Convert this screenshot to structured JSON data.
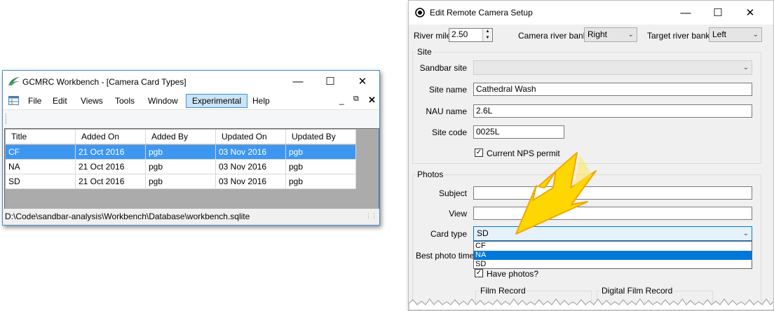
{
  "workbench": {
    "title": "GCMRC Workbench - [Camera Card Types]",
    "menu": [
      "File",
      "Edit",
      "Views",
      "Tools",
      "Window",
      "Experimental",
      "Help"
    ],
    "columns": [
      "Title",
      "Added On",
      "Added By",
      "Updated On",
      "Updated By"
    ],
    "rows": [
      [
        "CF",
        "21 Oct 2016",
        "pgb",
        "03 Nov 2016",
        "pgb"
      ],
      [
        "NA",
        "21 Oct 2016",
        "pgb",
        "03 Nov 2016",
        "pgb"
      ],
      [
        "SD",
        "21 Oct 2016",
        "pgb",
        "03 Nov 2016",
        "pgb"
      ]
    ],
    "status": "D:\\Code\\sandbar-analysis\\Workbench\\Database\\workbench.sqlite"
  },
  "dialog": {
    "title": "Edit Remote Camera Setup",
    "river_mile_label": "River mile",
    "river_mile_value": "2.50",
    "camera_bank_label": "Camera river bank",
    "camera_bank_value": "Right",
    "target_bank_label": "Target river bank",
    "target_bank_value": "Left",
    "site_group": "Site",
    "sandbar_label": "Sandbar site",
    "sandbar_value": "",
    "site_name_label": "Site name",
    "site_name_value": "Cathedral Wash",
    "nau_label": "NAU name",
    "nau_value": "2.6L",
    "site_code_label": "Site code",
    "site_code_value": "0025L",
    "nps_label": "Current NPS permit",
    "photos_group": "Photos",
    "subject_label": "Subject",
    "subject_value": "",
    "view_label": "View",
    "view_value": "",
    "card_type_label": "Card type",
    "card_type_value": "SD",
    "card_options": [
      "CF",
      "NA",
      "SD"
    ],
    "best_photo_label": "Best photo time",
    "have_photos_label": "Have photos?",
    "film_record_label": "Film Record",
    "digital_film_label": "Digital Film Record"
  },
  "colors": {
    "accent": "#0078d7",
    "selection": "#3d97f0",
    "arrow_fill": "#ffd700",
    "arrow_stroke": "#f0a800"
  }
}
